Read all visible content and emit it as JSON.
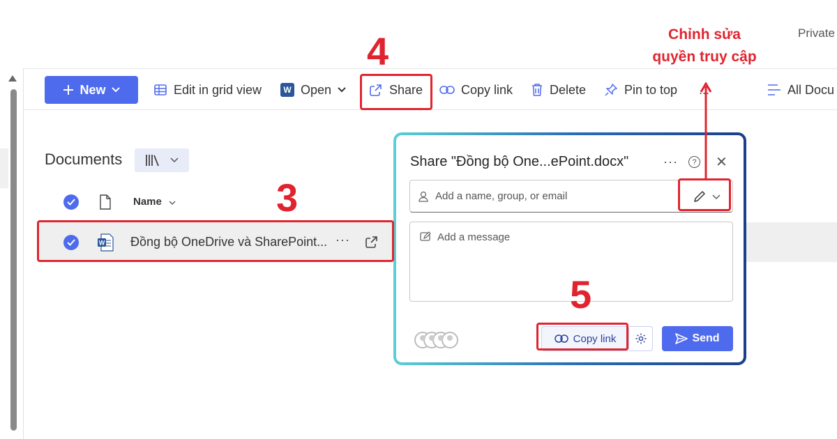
{
  "header": {
    "site_label": "Private"
  },
  "command_bar": {
    "new_label": "New",
    "edit_grid_label": "Edit in grid view",
    "open_label": "Open",
    "share_label": "Share",
    "copy_link_label": "Copy link",
    "delete_label": "Delete",
    "pin_label": "Pin to top",
    "more_label": "...",
    "view_label": "All Docu"
  },
  "library": {
    "title": "Documents",
    "name_column": "Name",
    "files": [
      {
        "name": "Đồng bộ OneDrive và SharePoint...",
        "icon": "word-doc-icon",
        "selected": true
      }
    ]
  },
  "share_dialog": {
    "title": "Share \"Đồng bộ One...ePoint.docx\"",
    "more": "···",
    "people_placeholder": "Add a name, group, or email",
    "message_placeholder": "Add a message",
    "copy_link_label": "Copy link",
    "send_label": "Send"
  },
  "annotations": {
    "step3": "3",
    "step4": "4",
    "step5": "5",
    "permission_note_line1": "Chỉnh sửa",
    "permission_note_line2": "quyền truy cập"
  },
  "colors": {
    "accent": "#4f6bed",
    "annotation": "#e0242f",
    "word": "#2b579a"
  }
}
